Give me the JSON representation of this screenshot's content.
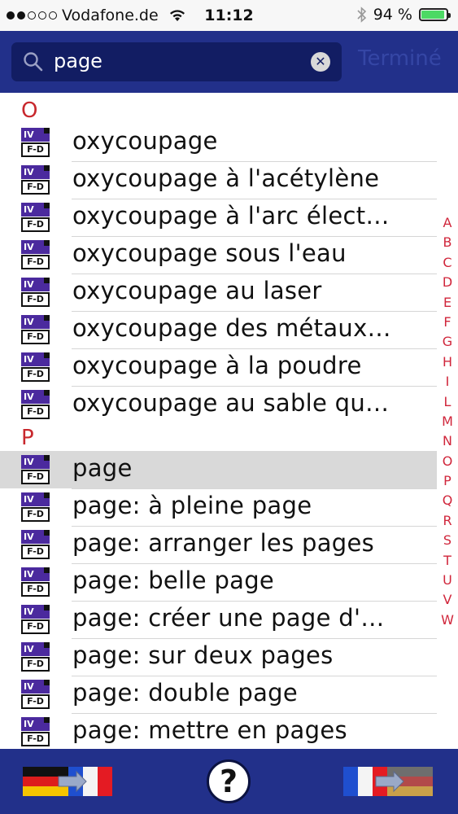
{
  "status_bar": {
    "carrier": "Vodafone.de",
    "time": "11:12",
    "battery": "94 %",
    "battery_level": 0.94,
    "signal_bars_filled": 2,
    "signal_bars_total": 5
  },
  "search": {
    "query": "page",
    "cancel_label": "Terminé"
  },
  "dict_icon": {
    "top": "IV",
    "bottom": "F-D"
  },
  "sections": [
    {
      "letter": "O",
      "items": [
        "oxycoupage",
        "oxycoupage à l'acétylène",
        "oxycoupage à l'arc élect…",
        "oxycoupage sous l'eau",
        "oxycoupage au laser",
        "oxycoupage des métaux…",
        "oxycoupage à la poudre",
        "oxycoupage au sable qu…"
      ]
    },
    {
      "letter": "P",
      "items": [
        "page",
        "page: à pleine page",
        "page: arranger les pages",
        "page: belle page",
        "page: créer une page d'…",
        "page: sur deux pages",
        "page: double page",
        "page: mettre en pages"
      ]
    }
  ],
  "selected_item": "page",
  "index_letters": [
    "A",
    "B",
    "C",
    "D",
    "E",
    "F",
    "G",
    "H",
    "I",
    "L",
    "M",
    "N",
    "O",
    "P",
    "Q",
    "R",
    "S",
    "T",
    "U",
    "V",
    "W"
  ],
  "toolbar": {
    "help_label": "?"
  },
  "colors": {
    "bar_blue": "#22308a",
    "search_field": "#121d63",
    "accent_red": "#c8282d",
    "index_red": "#d0263b",
    "selected_row": "#d9d9d9"
  }
}
